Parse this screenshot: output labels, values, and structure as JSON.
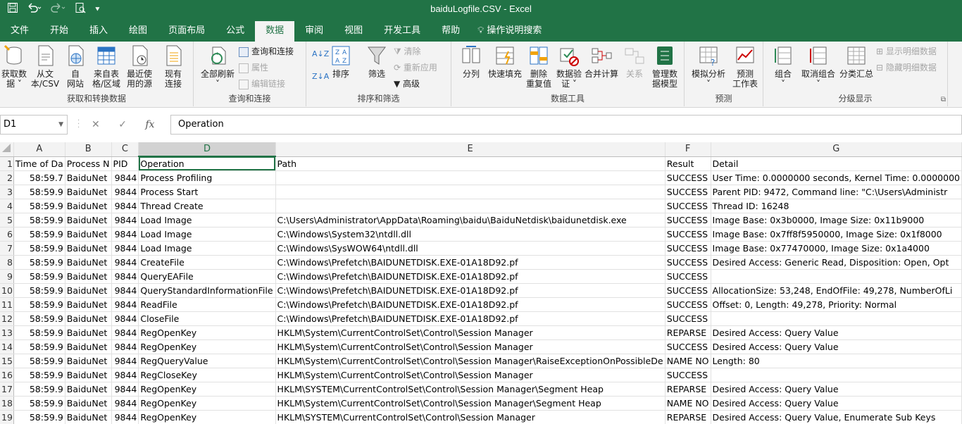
{
  "window": {
    "title": "baiduLogfile.CSV  -  Excel"
  },
  "tabs": [
    {
      "label": "文件"
    },
    {
      "label": "开始"
    },
    {
      "label": "插入"
    },
    {
      "label": "绘图"
    },
    {
      "label": "页面布局"
    },
    {
      "label": "公式"
    },
    {
      "label": "数据",
      "active": true
    },
    {
      "label": "审阅"
    },
    {
      "label": "视图"
    },
    {
      "label": "开发工具"
    },
    {
      "label": "帮助"
    },
    {
      "label": "操作说明搜索"
    }
  ],
  "ribbon": {
    "get_transform": {
      "label": "获取和转换数据",
      "buttons": [
        "获取数\n据 ˅",
        "从文\n本/CSV",
        "自\n网站",
        "来自表\n格/区域",
        "最近使\n用的源",
        "现有\n连接"
      ]
    },
    "queries": {
      "label": "查询和连接",
      "refresh": "全部刷新",
      "refresh_caret": "˅",
      "items": [
        "查询和连接",
        "属性",
        "编辑链接"
      ]
    },
    "sort_filter": {
      "label": "排序和筛选",
      "sort": "排序",
      "filter": "筛选",
      "items": [
        "清除",
        "重新应用",
        "高级"
      ]
    },
    "data_tools": {
      "label": "数据工具",
      "buttons": [
        "分列",
        "快速填充",
        "删除\n重复值",
        "数据验\n证 ˅",
        "合并计算",
        "关系",
        "管理数\n据模型"
      ]
    },
    "forecast": {
      "label": "预测",
      "buttons": [
        "模拟分析\n˅",
        "预测\n工作表"
      ]
    },
    "outline": {
      "label": "分级显示",
      "buttons": [
        "组合\n˅",
        "取消组合\n˅",
        "分类汇总"
      ],
      "items": [
        "显示明细数据",
        "隐藏明细数据"
      ]
    }
  },
  "formula_bar": {
    "name_box": "D1",
    "cancel": "✕",
    "enter": "✓",
    "fx": "fx",
    "value": "Operation"
  },
  "sheet": {
    "columns": [
      "A",
      "B",
      "C",
      "D",
      "E",
      "F",
      "G"
    ],
    "rows": [
      {
        "n": "1",
        "a": "Time of Da",
        "b": "Process N",
        "c": "PID",
        "d": "Operation",
        "e": "Path",
        "f": "Result",
        "g": "Detail"
      },
      {
        "n": "2",
        "a": "58:59.7",
        "b": "BaiduNet",
        "c": "9844",
        "d": "Process Profiling",
        "e": "",
        "f": "SUCCESS",
        "g": "User Time: 0.0000000 seconds, Kernel Time: 0.0000000"
      },
      {
        "n": "3",
        "a": "58:59.9",
        "b": "BaiduNet",
        "c": "9844",
        "d": "Process Start",
        "e": "",
        "f": "SUCCESS",
        "g": "Parent PID: 9472, Command line: \"C:\\Users\\Administr"
      },
      {
        "n": "4",
        "a": "58:59.9",
        "b": "BaiduNet",
        "c": "9844",
        "d": "Thread Create",
        "e": "",
        "f": "SUCCESS",
        "g": "Thread ID: 16248"
      },
      {
        "n": "5",
        "a": "58:59.9",
        "b": "BaiduNet",
        "c": "9844",
        "d": "Load Image",
        "e": "C:\\Users\\Administrator\\AppData\\Roaming\\baidu\\BaiduNetdisk\\baidunetdisk.exe",
        "f": "SUCCESS",
        "g": "Image Base: 0x3b0000, Image Size: 0x11b9000"
      },
      {
        "n": "6",
        "a": "58:59.9",
        "b": "BaiduNet",
        "c": "9844",
        "d": "Load Image",
        "e": "C:\\Windows\\System32\\ntdll.dll",
        "f": "SUCCESS",
        "g": "Image Base: 0x7ff8f5950000, Image Size: 0x1f8000"
      },
      {
        "n": "7",
        "a": "58:59.9",
        "b": "BaiduNet",
        "c": "9844",
        "d": "Load Image",
        "e": "C:\\Windows\\SysWOW64\\ntdll.dll",
        "f": "SUCCESS",
        "g": "Image Base: 0x77470000, Image Size: 0x1a4000"
      },
      {
        "n": "8",
        "a": "58:59.9",
        "b": "BaiduNet",
        "c": "9844",
        "d": "CreateFile",
        "e": "C:\\Windows\\Prefetch\\BAIDUNETDISK.EXE-01A18D92.pf",
        "f": "SUCCESS",
        "g": "Desired Access: Generic Read, Disposition: Open, Opt"
      },
      {
        "n": "9",
        "a": "58:59.9",
        "b": "BaiduNet",
        "c": "9844",
        "d": "QueryEAFile",
        "e": "C:\\Windows\\Prefetch\\BAIDUNETDISK.EXE-01A18D92.pf",
        "f": "SUCCESS",
        "g": ""
      },
      {
        "n": "10",
        "a": "58:59.9",
        "b": "BaiduNet",
        "c": "9844",
        "d": "QueryStandardInformationFile",
        "e": "C:\\Windows\\Prefetch\\BAIDUNETDISK.EXE-01A18D92.pf",
        "f": "SUCCESS",
        "g": "AllocationSize: 53,248, EndOfFile: 49,278, NumberOfLi"
      },
      {
        "n": "11",
        "a": "58:59.9",
        "b": "BaiduNet",
        "c": "9844",
        "d": "ReadFile",
        "e": "C:\\Windows\\Prefetch\\BAIDUNETDISK.EXE-01A18D92.pf",
        "f": "SUCCESS",
        "g": "Offset: 0, Length: 49,278, Priority: Normal"
      },
      {
        "n": "12",
        "a": "58:59.9",
        "b": "BaiduNet",
        "c": "9844",
        "d": "CloseFile",
        "e": "C:\\Windows\\Prefetch\\BAIDUNETDISK.EXE-01A18D92.pf",
        "f": "SUCCESS",
        "g": ""
      },
      {
        "n": "13",
        "a": "58:59.9",
        "b": "BaiduNet",
        "c": "9844",
        "d": "RegOpenKey",
        "e": "HKLM\\System\\CurrentControlSet\\Control\\Session Manager",
        "f": "REPARSE",
        "g": "Desired Access: Query Value"
      },
      {
        "n": "14",
        "a": "58:59.9",
        "b": "BaiduNet",
        "c": "9844",
        "d": "RegOpenKey",
        "e": "HKLM\\System\\CurrentControlSet\\Control\\Session Manager",
        "f": "SUCCESS",
        "g": "Desired Access: Query Value"
      },
      {
        "n": "15",
        "a": "58:59.9",
        "b": "BaiduNet",
        "c": "9844",
        "d": "RegQueryValue",
        "e": "HKLM\\System\\CurrentControlSet\\Control\\Session Manager\\RaiseExceptionOnPossibleDe",
        "f": "NAME NO",
        "g": "Length: 80"
      },
      {
        "n": "16",
        "a": "58:59.9",
        "b": "BaiduNet",
        "c": "9844",
        "d": "RegCloseKey",
        "e": "HKLM\\System\\CurrentControlSet\\Control\\Session Manager",
        "f": "SUCCESS",
        "g": ""
      },
      {
        "n": "17",
        "a": "58:59.9",
        "b": "BaiduNet",
        "c": "9844",
        "d": "RegOpenKey",
        "e": "HKLM\\SYSTEM\\CurrentControlSet\\Control\\Session Manager\\Segment Heap",
        "f": "REPARSE",
        "g": "Desired Access: Query Value"
      },
      {
        "n": "18",
        "a": "58:59.9",
        "b": "BaiduNet",
        "c": "9844",
        "d": "RegOpenKey",
        "e": "HKLM\\System\\CurrentControlSet\\Control\\Session Manager\\Segment Heap",
        "f": "NAME NO",
        "g": "Desired Access: Query Value"
      },
      {
        "n": "19",
        "a": "58:59.9",
        "b": "BaiduNet",
        "c": "9844",
        "d": "RegOpenKey",
        "e": "HKLM\\SYSTEM\\CurrentControlSet\\Control\\Session Manager",
        "f": "REPARSE",
        "g": "Desired Access: Query Value, Enumerate Sub Keys"
      }
    ]
  }
}
